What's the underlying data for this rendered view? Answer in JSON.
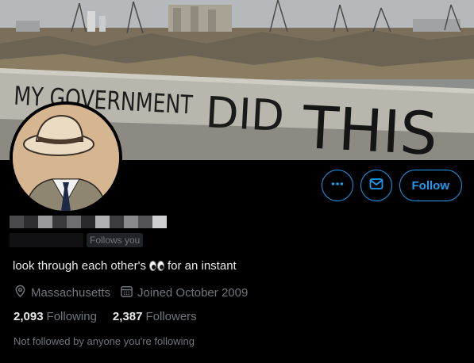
{
  "banner": {
    "graffiti_text": "MY GOVERNMENT DID THIS"
  },
  "actions": {
    "more_icon": "more-dots-icon",
    "message_icon": "envelope-icon",
    "follow_label": "Follow",
    "accent_color": "#1d9bf0"
  },
  "profile": {
    "follows_you_label": "Follows you",
    "bio_text": "look through each other's",
    "bio_emoji": "eyes-emoji",
    "bio_suffix": "for an instant",
    "location": "Massachusetts",
    "location_icon": "location-pin-icon",
    "joined": "Joined October 2009",
    "joined_icon": "calendar-icon"
  },
  "stats": {
    "following_count": "2,093",
    "following_label": "Following",
    "followers_count": "2,387",
    "followers_label": "Followers"
  },
  "mutuals_text": "Not followed by anyone you're following"
}
